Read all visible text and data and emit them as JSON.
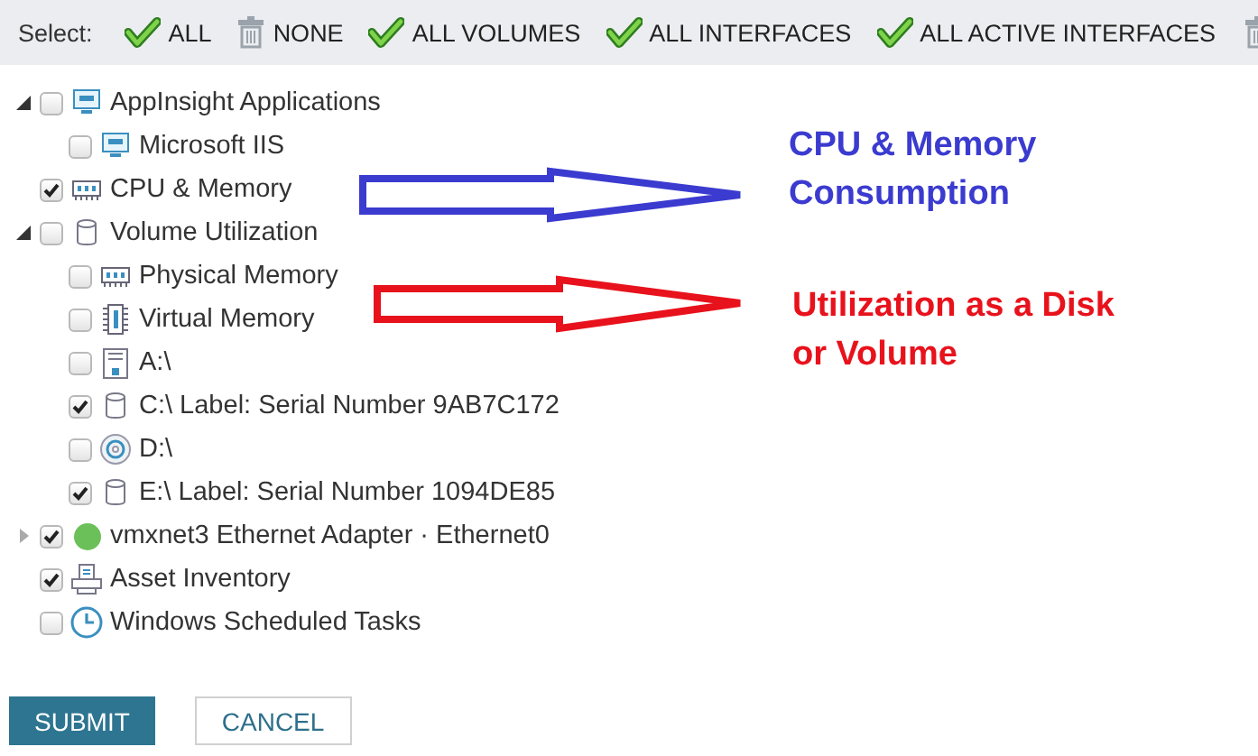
{
  "toolbar": {
    "label": "Select:",
    "actions": [
      {
        "kind": "check",
        "label": "ALL"
      },
      {
        "kind": "trash",
        "label": "NONE"
      },
      {
        "kind": "check",
        "label": "ALL VOLUMES"
      },
      {
        "kind": "check",
        "label": "ALL INTERFACES"
      },
      {
        "kind": "check",
        "label": "ALL ACTIVE INTERFACES"
      }
    ]
  },
  "tree": [
    {
      "label": "AppInsight Applications",
      "kind": "monitor",
      "checked": false,
      "expanded": true,
      "children": [
        {
          "label": "Microsoft IIS",
          "kind": "monitor",
          "checked": false
        }
      ]
    },
    {
      "label": "CPU & Memory",
      "kind": "ram",
      "checked": true
    },
    {
      "label": "Volume Utilization",
      "kind": "disk",
      "checked": false,
      "expanded": true,
      "children": [
        {
          "label": "Physical Memory",
          "kind": "ram",
          "checked": false
        },
        {
          "label": "Virtual Memory",
          "kind": "chip",
          "checked": false
        },
        {
          "label": "A:\\",
          "kind": "floppy",
          "checked": false
        },
        {
          "label": "C:\\ Label: Serial Number 9AB7C172",
          "kind": "disk",
          "checked": true
        },
        {
          "label": "D:\\",
          "kind": "cd",
          "checked": false
        },
        {
          "label": "E:\\ Label: Serial Number 1094DE85",
          "kind": "disk",
          "checked": true
        }
      ]
    },
    {
      "label": "vmxnet3 Ethernet Adapter · Ethernet0",
      "kind": "dot",
      "color": "#6cc05a",
      "checked": true,
      "expanded": false
    },
    {
      "label": "Asset Inventory",
      "kind": "printer",
      "checked": true
    },
    {
      "label": "Windows Scheduled Tasks",
      "kind": "clock",
      "checked": false
    }
  ],
  "buttons": [
    {
      "kind": "primary",
      "label": "SUBMIT"
    },
    {
      "kind": "secondary",
      "label": "CANCEL"
    }
  ],
  "annotations": [
    {
      "lines": [
        "CPU & Memory",
        "Consumption"
      ],
      "color": "#3b3bd0"
    },
    {
      "lines": [
        "Utilization as a Disk",
        "or Volume"
      ],
      "color": "#e8121c"
    }
  ]
}
